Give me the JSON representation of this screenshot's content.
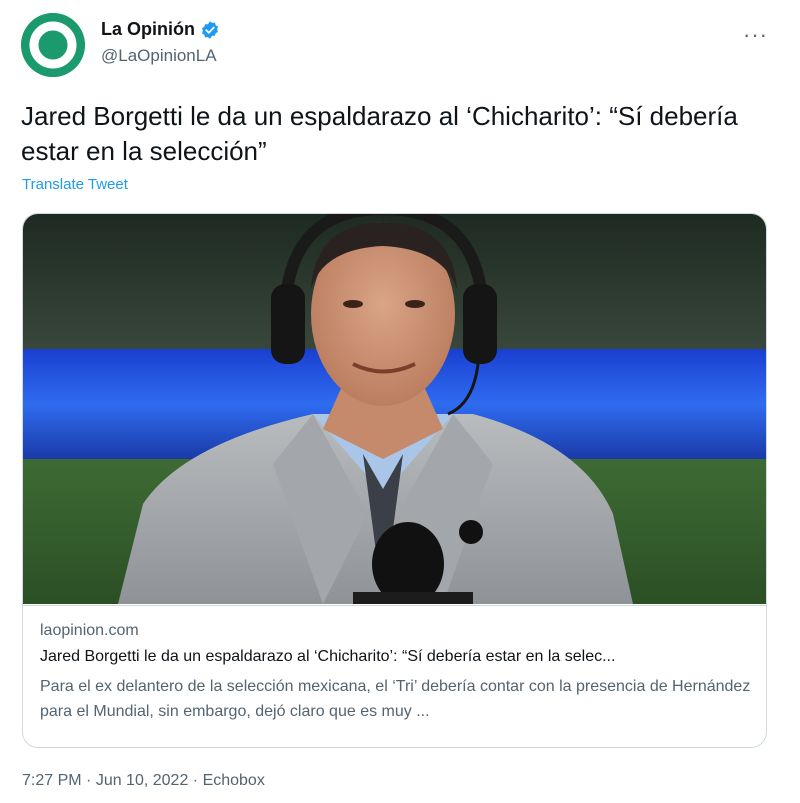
{
  "author": {
    "avatar_letter": "O",
    "display_name": "La Opinión",
    "handle": "@LaOpinionLA",
    "verified_icon": "verified-badge-icon"
  },
  "more_icon": "more-options-icon",
  "more_glyph": "···",
  "tweet": {
    "text": "Jared Borgetti le da un espaldarazo al ‘Chicharito’: “Sí debería estar en la selección”",
    "translate_label": "Translate Tweet"
  },
  "card": {
    "domain": "laopinion.com",
    "title": "Jared Borgetti le da un espaldarazo al ‘Chicharito’: “Sí debería estar en la selec...",
    "description": "Para el ex delantero de la selección mexicana, el ‘Tri’ debería contar con la presencia de Hernández para el Mundial, sin embargo, dejó claro que es muy ..."
  },
  "meta": {
    "time": "7:27 PM",
    "separator": " · ",
    "date": "Jun 10, 2022",
    "source": "Echobox"
  },
  "colors": {
    "brand_green": "#1b9a6e",
    "link_blue": "#1d9bf0",
    "secondary_text": "#536471",
    "border": "#cfd9de"
  }
}
